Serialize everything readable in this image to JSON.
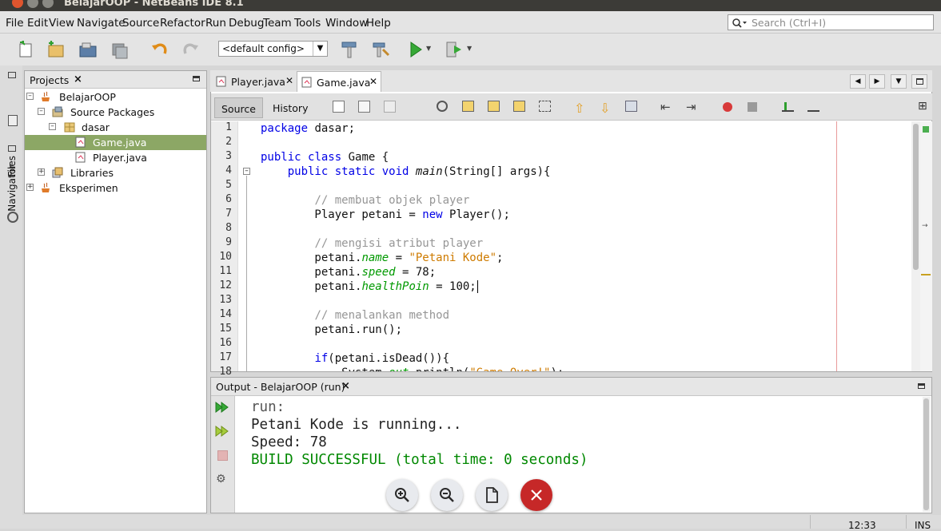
{
  "window": {
    "title": "BelajarOOP - NetBeans IDE 8.1"
  },
  "menu": [
    "File",
    "Edit",
    "View",
    "Navigate",
    "Source",
    "Refactor",
    "Run",
    "Debug",
    "Team",
    "Tools",
    "Window",
    "Help"
  ],
  "search": {
    "placeholder": "Search (Ctrl+I)"
  },
  "toolbar": {
    "config": "<default config>"
  },
  "side_strip": {
    "files": "Files",
    "navigator": "Navigator"
  },
  "projects": {
    "title": "Projects",
    "tree": [
      {
        "label": "BelajarOOP",
        "expanded": true
      },
      {
        "label": "Source Packages",
        "expanded": true
      },
      {
        "label": "dasar",
        "expanded": true
      },
      {
        "label": "Game.java",
        "selected": true
      },
      {
        "label": "Player.java"
      },
      {
        "label": "Libraries",
        "expanded": false
      },
      {
        "label": "Eksperimen",
        "expanded": false
      }
    ]
  },
  "editor": {
    "tabs": [
      {
        "label": "Player.java",
        "active": false
      },
      {
        "label": "Game.java",
        "active": true
      }
    ],
    "source_label": "Source",
    "history_label": "History",
    "line_numbers": [
      "1",
      "2",
      "3",
      "4",
      "5",
      "6",
      "7",
      "8",
      "9",
      "10",
      "11",
      "12",
      "13",
      "14",
      "15",
      "16",
      "17",
      "18"
    ],
    "code": [
      "package dasar;",
      "",
      "public class Game {",
      "    public static void main(String[] args){",
      "",
      "        // membuat objek player",
      "        Player petani = new Player();",
      "",
      "        // mengisi atribut player",
      "        petani.name = \"Petani Kode\";",
      "        petani.speed = 78;",
      "        petani.healthPoin = 100;",
      "",
      "        // menalankan method",
      "        petani.run();",
      "",
      "        if(petani.isDead()){",
      "            System.out.println(\"Game Over!\");"
    ]
  },
  "output": {
    "title": "Output - BelajarOOP (run)",
    "lines": [
      {
        "text": "run:",
        "color": "#555555"
      },
      {
        "text": "Petani Kode is running...",
        "color": "#222222"
      },
      {
        "text": "Speed: 78",
        "color": "#222222"
      },
      {
        "text": "BUILD SUCCESSFUL (total time: 0 seconds)",
        "color": "#008800"
      }
    ]
  },
  "zoom_controls": [
    "zoom-in",
    "zoom-out",
    "page",
    "close"
  ],
  "status": {
    "position": "12:33",
    "mode": "INS"
  },
  "colors": {
    "selection": "#8ca765",
    "keyword": "#0000e6",
    "string": "#ce7b00",
    "field": "#009900",
    "comment": "#969696",
    "close_button": "#c62828"
  }
}
